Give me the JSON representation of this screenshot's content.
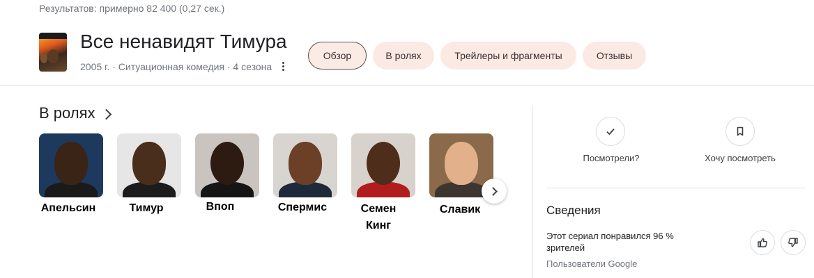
{
  "results": "Результатов: примерно 82 400 (0,27 сек.)",
  "header": {
    "title": "Все ненавидят Тимура",
    "subtitle": "2005 г. · Ситуационная комедия · 4 сезона"
  },
  "tabs": [
    {
      "label": "Обзор",
      "active": true
    },
    {
      "label": "В ролях",
      "active": false
    },
    {
      "label": "Трейлеры и фрагменты",
      "active": false
    },
    {
      "label": "Отзывы",
      "active": false
    }
  ],
  "cast_section": {
    "title": "В ролях",
    "cast": [
      {
        "name": "Апельсин"
      },
      {
        "name": "Тимур"
      },
      {
        "name": "Впоп"
      },
      {
        "name": "Спермис"
      },
      {
        "name": "Семен Кинг"
      },
      {
        "name": "Славик"
      }
    ]
  },
  "actions": {
    "watched_label": "Посмотрели?",
    "want_label": "Хочу посмотреть"
  },
  "info": {
    "title": "Сведения",
    "liked_text": "Этот сериал понравился 96 % зрителей",
    "source": "Пользователи Google"
  },
  "colors": {
    "tab_bg": "#fbe9e3",
    "text_primary": "#202124",
    "text_secondary": "#70757a"
  },
  "icons": {
    "more": "more-vert-icon",
    "next": "chevron-right-icon",
    "watched": "check-icon",
    "want": "bookmark-icon",
    "like": "thumb-up-icon",
    "dislike": "thumb-down-icon"
  }
}
